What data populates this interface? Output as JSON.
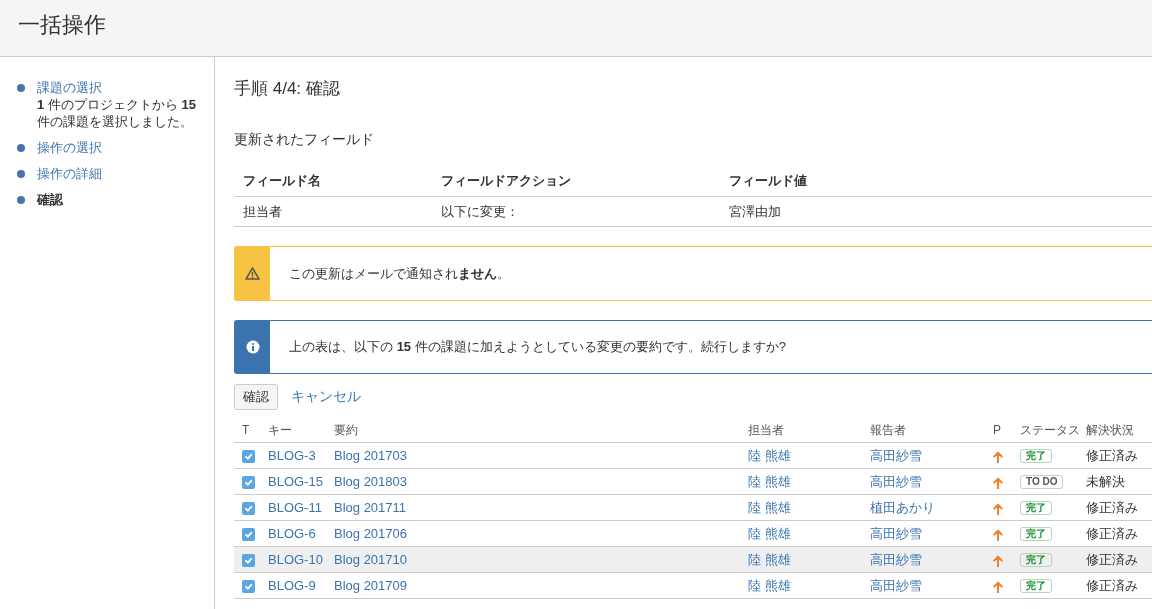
{
  "page_header": {
    "title": "一括操作"
  },
  "steps": [
    {
      "label": "課題の選択",
      "selected": false,
      "description": "**1** 件のプロジェクトから **15** 件の課題を選択しました。"
    },
    {
      "label": "操作の選択",
      "selected": false
    },
    {
      "label": "操作の詳細",
      "selected": false
    },
    {
      "label": "確認",
      "selected": true
    }
  ],
  "main": {
    "heading": "手順 4/4: 確認",
    "section_title": "更新されたフィールド",
    "fields_table": {
      "columns": [
        "フィールド名",
        "フィールドアクション",
        "フィールド値"
      ],
      "rows": [
        [
          "担当者",
          "以下に変更：",
          "宮澤由加"
        ]
      ]
    },
    "messages": [
      {
        "kind": "warning",
        "text": "この更新はメールで通知され**ません**。"
      },
      {
        "kind": "info",
        "text": "上の表は、以下の **15** 件の課題に加えようとしている変更の要約です。続行しますか?"
      }
    ],
    "confirm_button": "確認",
    "cancel_link": "キャンセル",
    "issues_table": {
      "columns": [
        "T",
        "キー",
        "要約",
        "担当者",
        "報告者",
        "P",
        "ステータス",
        "解決状況"
      ],
      "rows": [
        {
          "checked": true,
          "highlighted": false,
          "key": "BLOG-3",
          "summary": "Blog 201703",
          "assignee": "陸 熊雄",
          "reporter": "高田紗雪",
          "status": {
            "label": "完了",
            "kind": "done"
          },
          "resolution": "修正済み"
        },
        {
          "checked": true,
          "highlighted": false,
          "key": "BLOG-15",
          "summary": "Blog 201803",
          "assignee": "陸 熊雄",
          "reporter": "高田紗雪",
          "status": {
            "label": "TO DO",
            "kind": "todo"
          },
          "resolution": "未解決"
        },
        {
          "checked": true,
          "highlighted": false,
          "key": "BLOG-11",
          "summary": "Blog 201711",
          "assignee": "陸 熊雄",
          "reporter": "植田あかり",
          "status": {
            "label": "完了",
            "kind": "done"
          },
          "resolution": "修正済み"
        },
        {
          "checked": true,
          "highlighted": false,
          "key": "BLOG-6",
          "summary": "Blog 201706",
          "assignee": "陸 熊雄",
          "reporter": "高田紗雪",
          "status": {
            "label": "完了",
            "kind": "done"
          },
          "resolution": "修正済み"
        },
        {
          "checked": true,
          "highlighted": true,
          "key": "BLOG-10",
          "summary": "Blog 201710",
          "assignee": "陸 熊雄",
          "reporter": "高田紗雪",
          "status": {
            "label": "完了",
            "kind": "done"
          },
          "resolution": "修正済み"
        },
        {
          "checked": true,
          "highlighted": false,
          "key": "BLOG-9",
          "summary": "Blog 201709",
          "assignee": "陸 熊雄",
          "reporter": "高田紗雪",
          "status": {
            "label": "完了",
            "kind": "done"
          },
          "resolution": "修正済み"
        }
      ]
    }
  }
}
